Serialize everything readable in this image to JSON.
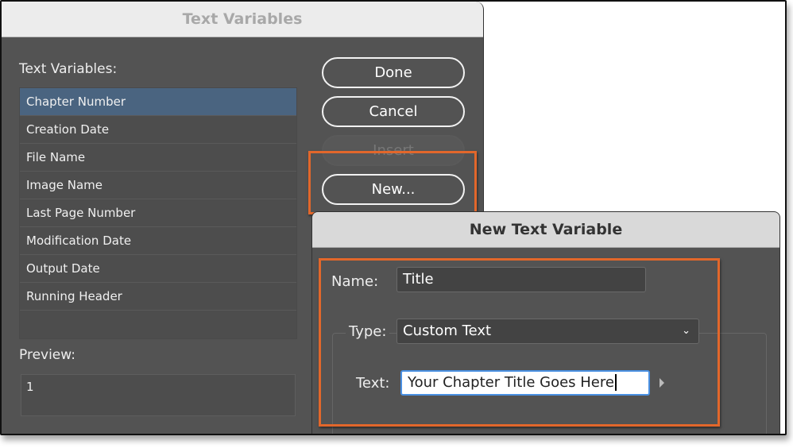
{
  "text_variables_dialog": {
    "title": "Text Variables",
    "list_label": "Text Variables:",
    "items": [
      "Chapter Number",
      "Creation Date",
      "File Name",
      "Image Name",
      "Last Page Number",
      "Modification Date",
      "Output Date",
      "Running Header"
    ],
    "selected": "Chapter Number",
    "preview_label": "Preview:",
    "preview_value": "1",
    "buttons": {
      "done": "Done",
      "cancel": "Cancel",
      "insert": "Insert",
      "new": "New..."
    }
  },
  "new_text_variable_dialog": {
    "title": "New Text Variable",
    "name_label": "Name:",
    "name_value": "Title",
    "type_label": "Type:",
    "type_value": "Custom Text",
    "text_label": "Text:",
    "text_value": "Your Chapter Title Goes Here"
  },
  "colors": {
    "highlight": "#e2672b",
    "selection": "#4a6480",
    "focus": "#4a90e2"
  },
  "icons": {
    "dropdown": "chevron-down-icon",
    "insert_special": "triangle-right-icon"
  }
}
